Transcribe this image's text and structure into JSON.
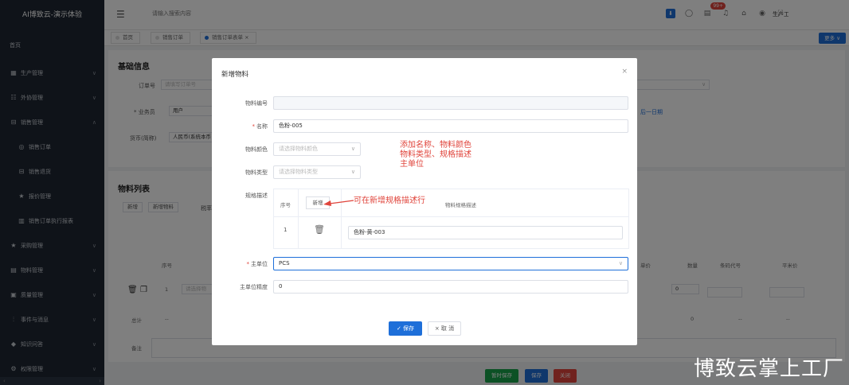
{
  "sidebar": {
    "title": "AI博致云-演示体验",
    "home": "首页",
    "items": [
      {
        "label": "生产管理",
        "icon": "grid-icon"
      },
      {
        "label": "外协管理",
        "icon": "outsource-icon"
      },
      {
        "label": "销售管理",
        "icon": "sales-icon"
      },
      {
        "label": "销售订单",
        "icon": "order-icon"
      },
      {
        "label": "销售退货",
        "icon": "return-icon"
      },
      {
        "label": "报价管理",
        "icon": "star-icon"
      },
      {
        "label": "销售订单执行报表",
        "icon": "report-icon"
      },
      {
        "label": "采购管理",
        "icon": "star-icon"
      },
      {
        "label": "物料管理",
        "icon": "table-icon"
      },
      {
        "label": "质量管理",
        "icon": "quality-icon"
      },
      {
        "label": "事件与消息",
        "icon": "event-icon"
      },
      {
        "label": "知识问答",
        "icon": "knowledge-icon"
      },
      {
        "label": "权限管理",
        "icon": "permission-icon"
      }
    ]
  },
  "header": {
    "search_placeholder": "请输入搜索内容",
    "badge": "99+",
    "user": "生产工"
  },
  "tabs": [
    {
      "label": "首页"
    },
    {
      "label": "销售订单"
    },
    {
      "label": "销售订单表单 ×"
    }
  ],
  "more_label": "更多 ∨",
  "background": {
    "basic_info_title": "基础信息",
    "order_no_label": "订单号",
    "order_no_placeholder": "请填写订单号",
    "salesman_label": "* 业务员",
    "salesman_value": "用户",
    "currency_label": "货币(简称)",
    "currency_value": "人民币(系统本币",
    "next_day_link": "后一日期",
    "material_list_title": "物料列表",
    "btn_add": "新增",
    "btn_add_material": "新增物料",
    "tax_label": "税率",
    "col_seq": "序号",
    "col_qty": "数量",
    "col_bar": "条码代号",
    "col_sqm": "平米价",
    "col_unit_price": "单价",
    "row_seq": "1",
    "row_placeholder": "请选择物",
    "row_qty": "0",
    "total_label": "总计",
    "total_dash": "--",
    "total_zero": "0",
    "remark_label": "备注",
    "btn_temp_save": "暂时保存",
    "btn_save": "保存",
    "btn_close": "关闭"
  },
  "modal": {
    "title": "新增物料",
    "fields": {
      "code_label": "物料编号",
      "name_label": "名称",
      "name_value": "色粉-005",
      "color_label": "物料颜色",
      "color_placeholder": "请选择物料颜色",
      "type_label": "物料类型",
      "type_placeholder": "请选择物料类型",
      "spec_label": "规格描述",
      "spec_col_seq": "序号",
      "spec_add_btn": "新增",
      "spec_col_desc": "物料规格描述",
      "spec_row_seq": "1",
      "spec_row_value": "色粉-黄-003",
      "unit_label": "主单位",
      "unit_value": "PCS",
      "precision_label": "主单位精度",
      "precision_value": "0"
    },
    "annotation_1": [
      "添加名称、物料颜色",
      "物料类型、规格描述",
      "主单位"
    ],
    "annotation_2": "可在新增规格描述行",
    "save_label": "✓ 保存",
    "cancel_label": "× 取 消"
  },
  "watermark": "博致云掌上工厂",
  "colors": {
    "primary": "#1e6fd9",
    "sidebar_bg": "#1f2733",
    "annotation": "#e0453c",
    "green_btn": "#19a34b",
    "red_btn": "#e0453c"
  }
}
